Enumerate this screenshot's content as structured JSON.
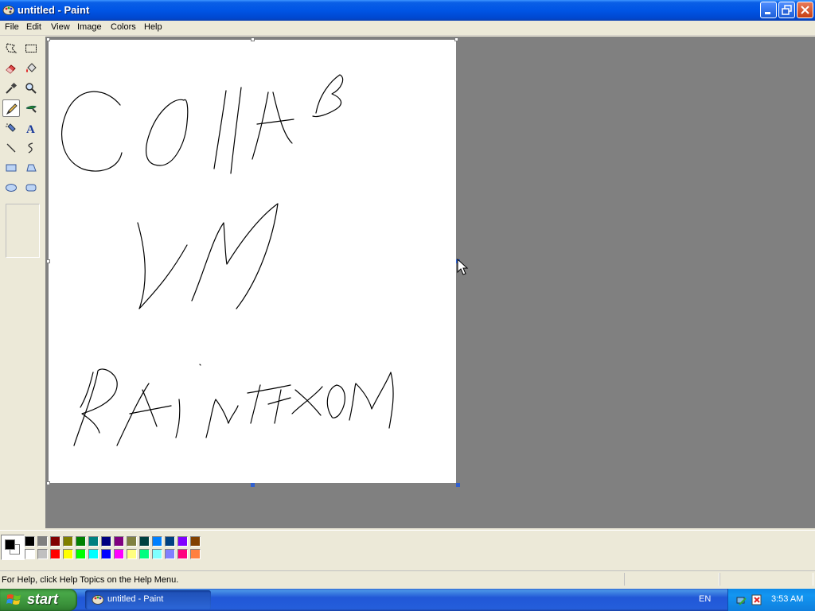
{
  "window": {
    "title": "untitled - Paint"
  },
  "menu": [
    "File",
    "Edit",
    "View",
    "Image",
    "Colors",
    "Help"
  ],
  "tools": [
    "free-form-select",
    "select",
    "eraser",
    "fill-with-color",
    "pick-color",
    "magnifier",
    "pencil",
    "brush",
    "airbrush",
    "text",
    "line",
    "curve",
    "rectangle",
    "polygon",
    "ellipse",
    "rounded-rectangle"
  ],
  "selected_tool": "pencil",
  "palette": {
    "row1": [
      "#000000",
      "#808080",
      "#800000",
      "#808000",
      "#008000",
      "#008080",
      "#000080",
      "#800080",
      "#808040",
      "#004040",
      "#0080ff",
      "#004080",
      "#8000ff",
      "#804000"
    ],
    "row2": [
      "#ffffff",
      "#c0c0c0",
      "#ff0000",
      "#ffff00",
      "#00ff00",
      "#00ffff",
      "#0000ff",
      "#ff00ff",
      "#ffff80",
      "#00ff80",
      "#80ffff",
      "#8080ff",
      "#ff0080",
      "#ff8040"
    ]
  },
  "foreground_color": "#000000",
  "background_color": "#ffffff",
  "status": {
    "help_text": "For Help, click Help Topics on the Help Menu."
  },
  "taskbar": {
    "start_label": "start",
    "task_label": "untitled - Paint",
    "language": "EN",
    "clock": "3:53 AM"
  }
}
